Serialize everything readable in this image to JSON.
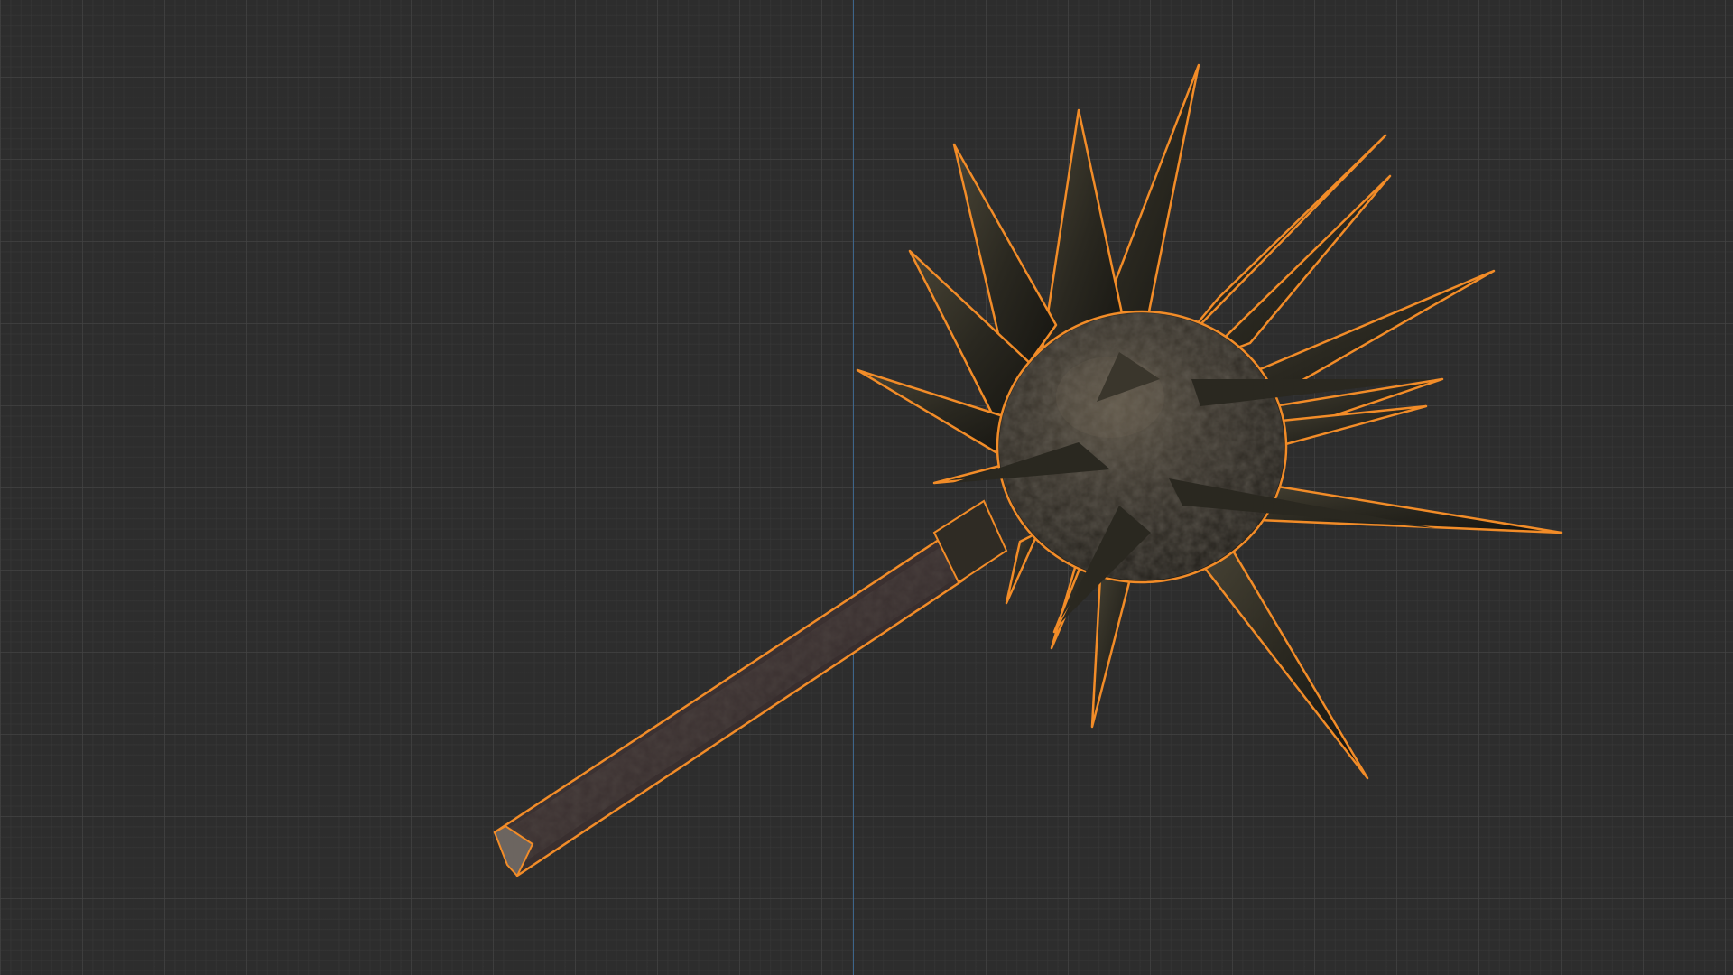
{
  "viewport": {
    "background_color": "#2d2d2d",
    "grid_color": "#464646",
    "y_axis_color": "#3f6c96"
  },
  "selected_object": {
    "name": "",
    "selection_outline_color": "#f28c28",
    "selected": true
  },
  "icons": {
    "object": "spiked-mace-model"
  }
}
